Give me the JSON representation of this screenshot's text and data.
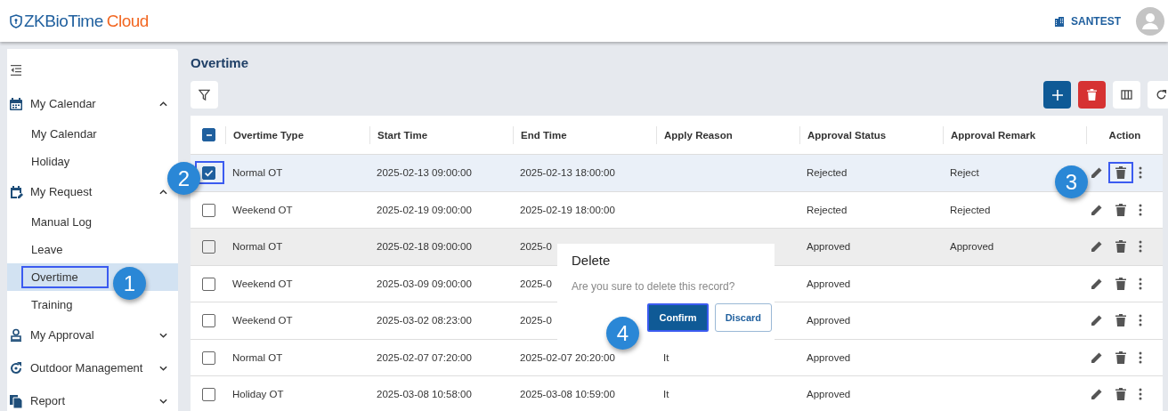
{
  "header": {
    "logo_main": "ZKBioTime",
    "logo_accent": "Cloud",
    "company": "SANTEST"
  },
  "sidebar": {
    "groups": [
      {
        "label": "My Calendar",
        "expanded": true,
        "children": [
          {
            "label": "My Calendar",
            "selected": false,
            "highlighted": false
          },
          {
            "label": "Holiday",
            "selected": false,
            "highlighted": false
          }
        ]
      },
      {
        "label": "My Request",
        "expanded": true,
        "children": [
          {
            "label": "Manual Log",
            "selected": false,
            "highlighted": false
          },
          {
            "label": "Leave",
            "selected": false,
            "highlighted": false
          },
          {
            "label": "Overtime",
            "selected": true,
            "highlighted": true
          },
          {
            "label": "Training",
            "selected": false,
            "highlighted": false
          }
        ]
      },
      {
        "label": "My Approval",
        "expanded": false
      },
      {
        "label": "Outdoor Management",
        "expanded": false
      },
      {
        "label": "Report",
        "expanded": false
      }
    ]
  },
  "page": {
    "title": "Overtime"
  },
  "table": {
    "select_all_indeterminate": true,
    "columns": [
      "Overtime Type",
      "Start Time",
      "End Time",
      "Apply Reason",
      "Approval Status",
      "Approval Remark",
      "Action"
    ],
    "rows": [
      {
        "selected": true,
        "checkbox_highlighted": true,
        "delete_highlighted": true,
        "hovered": false,
        "cells": [
          "Normal OT",
          "2025-02-13 09:00:00",
          "2025-02-13 18:00:00",
          "",
          "Rejected",
          "Reject"
        ]
      },
      {
        "selected": false,
        "checkbox_highlighted": false,
        "delete_highlighted": false,
        "hovered": false,
        "cells": [
          "Weekend OT",
          "2025-02-19 09:00:00",
          "2025-02-19 18:00:00",
          "",
          "Rejected",
          "Rejected"
        ]
      },
      {
        "selected": false,
        "checkbox_highlighted": false,
        "delete_highlighted": false,
        "hovered": true,
        "cells": [
          "Normal OT",
          "2025-02-18 09:00:00",
          "2025-0",
          "",
          "Approved",
          "Approved"
        ]
      },
      {
        "selected": false,
        "checkbox_highlighted": false,
        "delete_highlighted": false,
        "hovered": false,
        "cells": [
          "Weekend OT",
          "2025-03-09 09:00:00",
          "2025-0",
          "",
          "Approved",
          ""
        ]
      },
      {
        "selected": false,
        "checkbox_highlighted": false,
        "delete_highlighted": false,
        "hovered": false,
        "cells": [
          "Weekend OT",
          "2025-03-02 08:23:00",
          "2025-0",
          "",
          "Approved",
          ""
        ]
      },
      {
        "selected": false,
        "checkbox_highlighted": false,
        "delete_highlighted": false,
        "hovered": false,
        "cells": [
          "Normal OT",
          "2025-02-07 07:20:00",
          "2025-02-07 20:20:00",
          "It",
          "Approved",
          ""
        ]
      },
      {
        "selected": false,
        "checkbox_highlighted": false,
        "delete_highlighted": false,
        "hovered": false,
        "cells": [
          "Holiday OT",
          "2025-03-08 10:58:00",
          "2025-03-08 10:59:00",
          "It",
          "Approved",
          ""
        ]
      }
    ]
  },
  "dialog": {
    "title": "Delete",
    "message": "Are you sure to delete this record?",
    "confirm": "Confirm",
    "confirm_highlighted": true,
    "discard": "Discard"
  },
  "callouts": [
    "1",
    "2",
    "3",
    "4"
  ]
}
